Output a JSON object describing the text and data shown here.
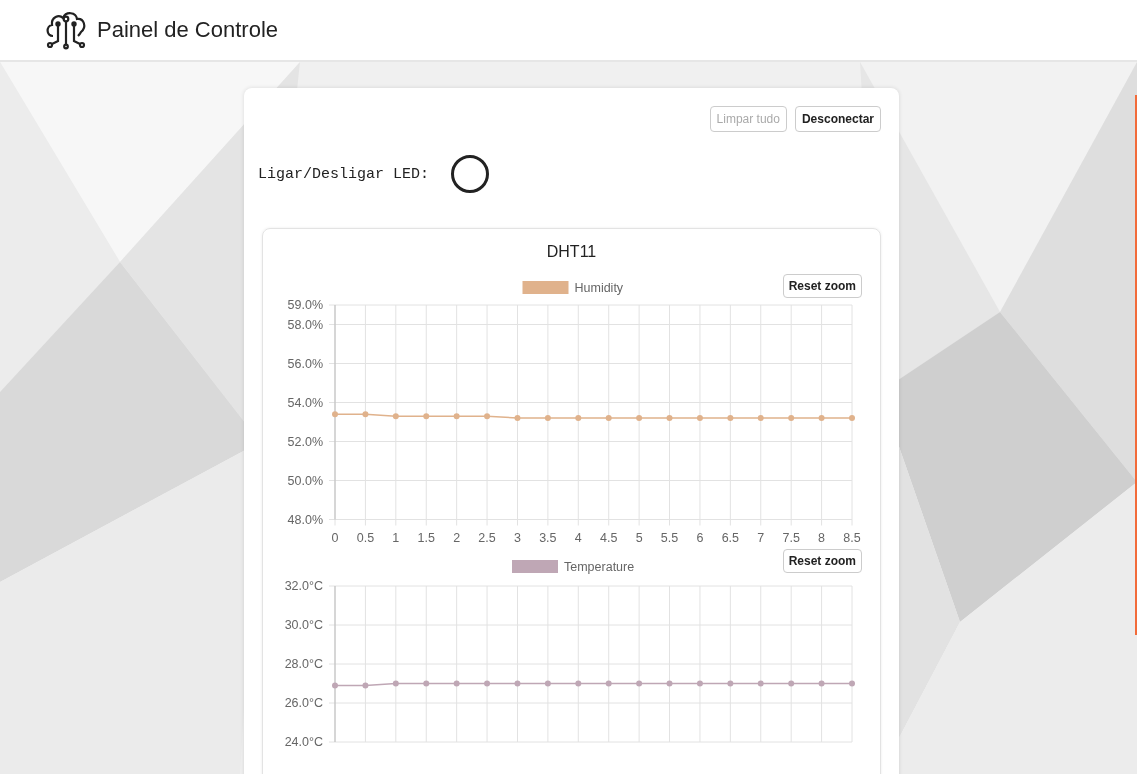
{
  "header": {
    "title": "Painel de Controle"
  },
  "buttons": [
    {
      "label": "Limpar tudo",
      "disabled": true
    },
    {
      "label": "Desconectar",
      "disabled": false
    }
  ],
  "led": {
    "label": "Ligar/Desligar LED:",
    "on": false
  },
  "sensor_panel": {
    "title": "DHT11",
    "charts": [
      {
        "reset_button": "Reset zoom",
        "chart_data": {
          "type": "line",
          "x": [
            0,
            0.5,
            1,
            1.5,
            2,
            2.5,
            3,
            3.5,
            4,
            4.5,
            5,
            5.5,
            6,
            6.5,
            7,
            7.5,
            8,
            8.5
          ],
          "grid": true,
          "series": [
            {
              "name": "Humidity",
              "color": "#e0b28c",
              "marker": "circle",
              "values": [
                53.4,
                53.4,
                53.3,
                53.3,
                53.3,
                53.3,
                53.2,
                53.2,
                53.2,
                53.2,
                53.2,
                53.2,
                53.2,
                53.2,
                53.2,
                53.2,
                53.2,
                53.2
              ]
            }
          ],
          "xlim": [
            0,
            8.5
          ],
          "ylim": [
            48,
            59
          ],
          "xticks": [
            0,
            0.5,
            1,
            1.5,
            2,
            2.5,
            3,
            3.5,
            4,
            4.5,
            5,
            5.5,
            6,
            6.5,
            7,
            7.5,
            8,
            8.5
          ],
          "yticks": [
            {
              "value": 48,
              "label": "48.0%"
            },
            {
              "value": 50,
              "label": "50.0%"
            },
            {
              "value": 52,
              "label": "52.0%"
            },
            {
              "value": 54,
              "label": "54.0%"
            },
            {
              "value": 56,
              "label": "56.0%"
            },
            {
              "value": 58,
              "label": "58.0%"
            },
            {
              "value": 59,
              "label": "59.0%"
            }
          ]
        }
      },
      {
        "reset_button": "Reset zoom",
        "chart_data": {
          "type": "line",
          "x": [
            0,
            0.5,
            1,
            1.5,
            2,
            2.5,
            3,
            3.5,
            4,
            4.5,
            5,
            5.5,
            6,
            6.5,
            7,
            7.5,
            8,
            8.5
          ],
          "grid": true,
          "series": [
            {
              "name": "Temperature",
              "color": "#bfa7b5",
              "marker": "circle",
              "values": [
                26.9,
                26.9,
                27.0,
                27.0,
                27.0,
                27.0,
                27.0,
                27.0,
                27.0,
                27.0,
                27.0,
                27.0,
                27.0,
                27.0,
                27.0,
                27.0,
                27.0,
                27.0
              ]
            }
          ],
          "xlim": [
            0,
            8.5
          ],
          "ylim": [
            24,
            32
          ],
          "yticks": [
            {
              "value": 24,
              "label": "24.0°C"
            },
            {
              "value": 26,
              "label": "26.0°C"
            },
            {
              "value": 28,
              "label": "28.0°C"
            },
            {
              "value": 30,
              "label": "30.0°C"
            },
            {
              "value": 32,
              "label": "32.0°C"
            }
          ]
        }
      }
    ]
  }
}
